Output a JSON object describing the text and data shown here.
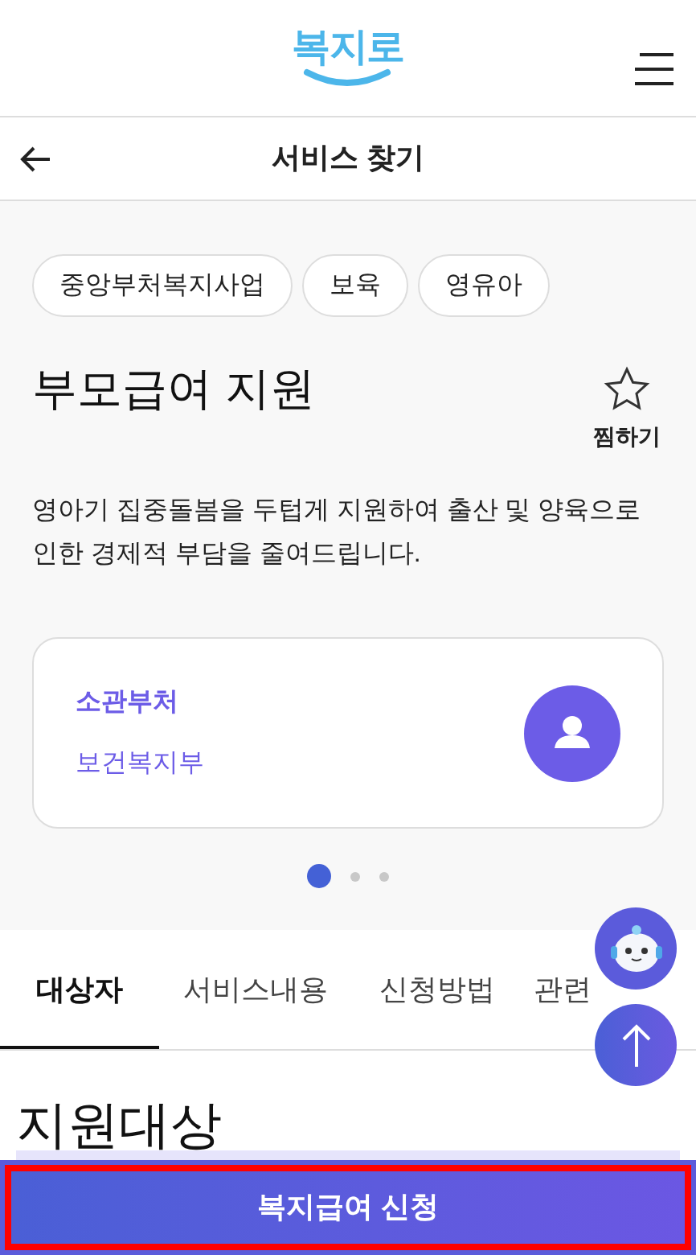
{
  "header": {
    "logo": "복지로"
  },
  "nav": {
    "title": "서비스 찾기"
  },
  "tags": [
    "중앙부처복지사업",
    "보육",
    "영유아"
  ],
  "service": {
    "title": "부모급여 지원",
    "favorite": {
      "label": "찜하기",
      "selected": false
    },
    "description": "영아기 집중돌봄을 두텁게 지원하여 출산 및 양육으로 인한 경제적 부담을 줄여드립니다."
  },
  "card": {
    "label": "소관부처",
    "value": "보건복지부"
  },
  "pager": [
    {
      "selected": true
    },
    {
      "selected": false
    },
    {
      "selected": false
    }
  ],
  "tabs": [
    {
      "label": "대상자",
      "selected": true
    },
    {
      "label": "서비스내용",
      "selected": false
    },
    {
      "label": "신청방법",
      "selected": false
    },
    {
      "label": "관련",
      "selected": false
    }
  ],
  "section": {
    "heading": "지원대상"
  },
  "apply_button": "복지급여 신청"
}
